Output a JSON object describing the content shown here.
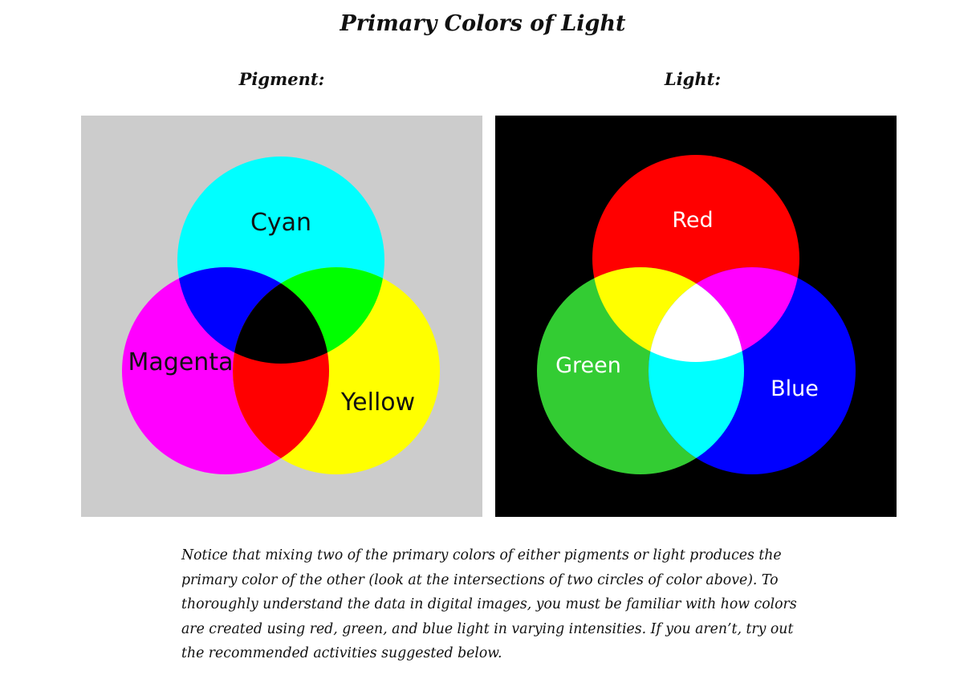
{
  "title": "Primary Colors of Light",
  "panels": {
    "pigment": {
      "label": "Pigment:",
      "background": "#cccccc",
      "circles": [
        {
          "name": "Cyan",
          "color": "#00ffff"
        },
        {
          "name": "Magenta",
          "color": "#ff00ff"
        },
        {
          "name": "Yellow",
          "color": "#ffff00"
        }
      ],
      "overlaps": {
        "cyan_magenta": "#0000ff",
        "cyan_yellow": "#00ff00",
        "magenta_yellow": "#ff0000",
        "all": "#000000"
      }
    },
    "light": {
      "label": "Light:",
      "background": "#000000",
      "circles": [
        {
          "name": "Red",
          "color": "#ff0000"
        },
        {
          "name": "Green",
          "color": "#33cc33"
        },
        {
          "name": "Blue",
          "color": "#0000ff"
        }
      ],
      "overlaps": {
        "red_green": "#ffff00",
        "red_blue": "#ff00ff",
        "green_blue": "#00ffff",
        "all": "#ffffff"
      }
    }
  },
  "caption": "Notice that mixing two of the primary colors of either pigments or light produces the primary color of the other (look at the intersections of two circles of color above). To thoroughly understand the data in digital images, you must be familiar with how colors are created using red, green, and blue light in varying intensities.  If you aren’t, try out the recommended activities suggested below."
}
